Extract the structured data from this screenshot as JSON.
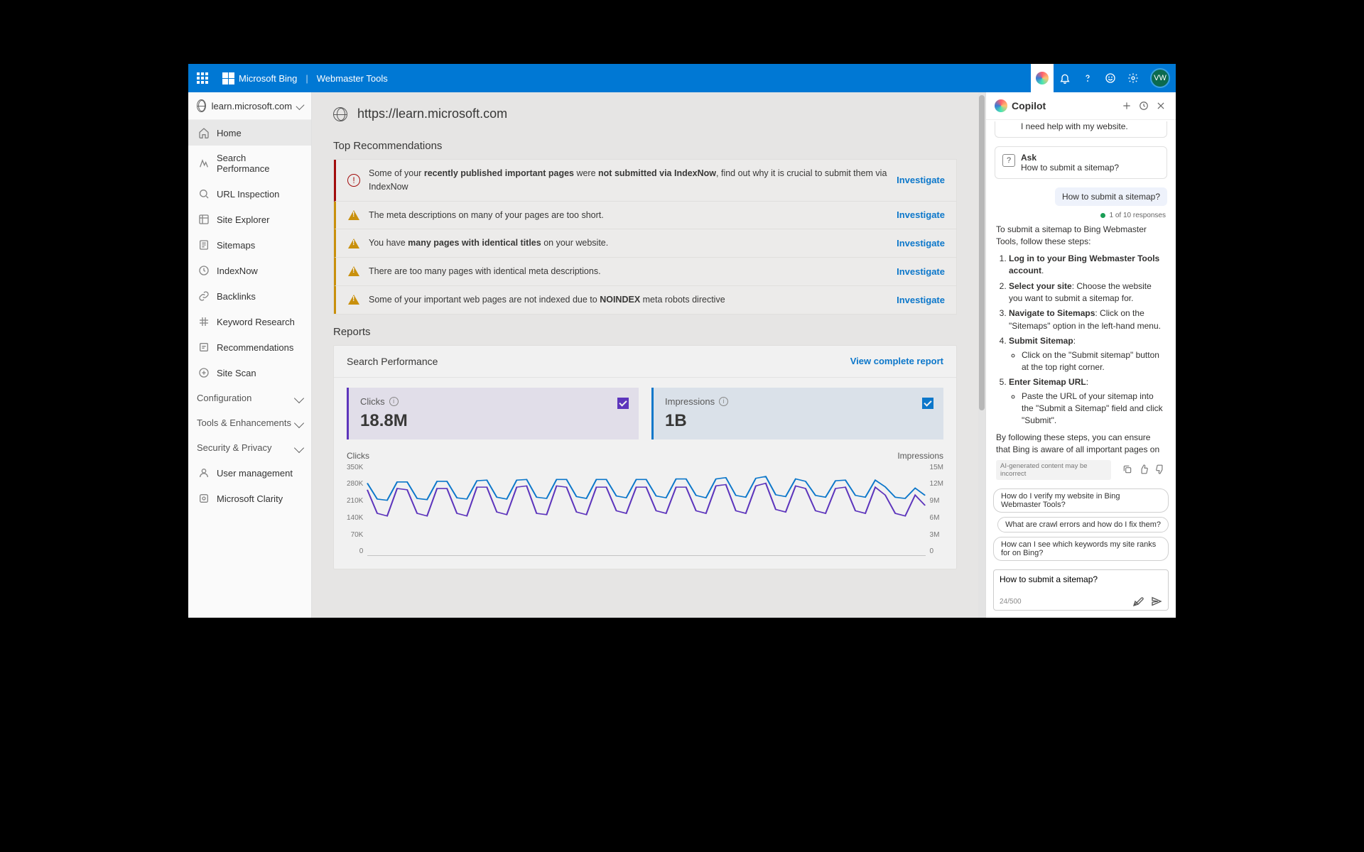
{
  "header": {
    "brand1": "Microsoft Bing",
    "brand2": "Webmaster Tools",
    "avatar": "VW"
  },
  "sidebar": {
    "site": "learn.microsoft.com",
    "items": [
      {
        "label": "Home",
        "active": true
      },
      {
        "label": "Search Performance"
      },
      {
        "label": "URL Inspection"
      },
      {
        "label": "Site Explorer"
      },
      {
        "label": "Sitemaps"
      },
      {
        "label": "IndexNow"
      },
      {
        "label": "Backlinks"
      },
      {
        "label": "Keyword Research"
      },
      {
        "label": "Recommendations"
      },
      {
        "label": "Site Scan"
      }
    ],
    "sections": [
      {
        "label": "Configuration"
      },
      {
        "label": "Tools & Enhancements"
      },
      {
        "label": "Security & Privacy"
      }
    ],
    "bottom": [
      {
        "label": "User management"
      },
      {
        "label": "Microsoft Clarity"
      }
    ]
  },
  "main": {
    "url": "https://learn.microsoft.com",
    "top_rec_title": "Top Recommendations",
    "investigate": "Investigate",
    "recs": [
      {
        "sev": "err",
        "html": "Some of your <b>recently published important pages</b> were <b>not submitted via IndexNow</b>, find out why it is crucial to submit them via IndexNow"
      },
      {
        "sev": "warn",
        "html": "The meta descriptions on many of your pages are too short."
      },
      {
        "sev": "warn",
        "html": "You have <b>many pages with identical titles</b> on your website."
      },
      {
        "sev": "warn",
        "html": "There are too many pages with identical meta descriptions."
      },
      {
        "sev": "warn",
        "html": "Some of your important web pages are not indexed due to <b>NOINDEX</b> meta robots directive"
      }
    ],
    "reports_title": "Reports",
    "report": {
      "title": "Search Performance",
      "view": "View complete report",
      "clicks_label": "Clicks",
      "clicks_value": "18.8M",
      "impr_label": "Impressions",
      "impr_value": "1B",
      "left_axis_label": "Clicks",
      "right_axis_label": "Impressions"
    }
  },
  "chart_data": {
    "type": "line",
    "xlabel": "",
    "ylabel_left": "Clicks",
    "ylabel_right": "Impressions",
    "left_ticks": [
      "350K",
      "280K",
      "210K",
      "140K",
      "70K",
      "0"
    ],
    "right_ticks": [
      "15M",
      "12M",
      "9M",
      "6M",
      "3M",
      "0"
    ],
    "left_range": [
      0,
      350000
    ],
    "right_range": [
      0,
      15000000
    ],
    "series": [
      {
        "name": "Clicks",
        "axis": "left",
        "color": "#5b2ec4",
        "values": [
          250000,
          160000,
          150000,
          255000,
          250000,
          160000,
          150000,
          255000,
          255000,
          160000,
          150000,
          260000,
          260000,
          165000,
          155000,
          260000,
          265000,
          160000,
          155000,
          265000,
          260000,
          165000,
          155000,
          260000,
          260000,
          170000,
          160000,
          260000,
          260000,
          170000,
          160000,
          260000,
          260000,
          170000,
          160000,
          265000,
          270000,
          170000,
          160000,
          265000,
          275000,
          175000,
          165000,
          265000,
          255000,
          170000,
          160000,
          255000,
          260000,
          170000,
          160000,
          260000,
          230000,
          160000,
          150000,
          230000,
          190000
        ]
      },
      {
        "name": "Impressions",
        "axis": "right",
        "color": "#0078D4",
        "values": [
          11800000,
          9200000,
          9000000,
          12000000,
          12000000,
          9300000,
          9100000,
          12100000,
          12100000,
          9400000,
          9200000,
          12200000,
          12300000,
          9500000,
          9200000,
          12300000,
          12400000,
          9500000,
          9300000,
          12400000,
          12400000,
          9600000,
          9300000,
          12400000,
          12400000,
          9700000,
          9400000,
          12400000,
          12400000,
          9700000,
          9400000,
          12500000,
          12500000,
          9800000,
          9400000,
          12500000,
          12700000,
          9800000,
          9500000,
          12600000,
          12900000,
          9900000,
          9600000,
          12500000,
          12100000,
          9800000,
          9500000,
          12200000,
          12300000,
          9800000,
          9500000,
          12300000,
          11200000,
          9500000,
          9300000,
          11000000,
          9800000
        ]
      }
    ]
  },
  "copilot": {
    "title": "Copilot",
    "sugg_top_text": "I need help with my website.",
    "sugg_ask_title": "Ask",
    "sugg_ask_text": "How to submit a sitemap?",
    "user_msg": "How to submit a sitemap?",
    "meta": "1 of 10 responses",
    "intro": "To submit a sitemap to Bing Webmaster Tools, follow these steps:",
    "step1_b": "Log in to your Bing Webmaster Tools account",
    "step1_t": ".",
    "step2_b": "Select your site",
    "step2_t": ": Choose the website you want to submit a sitemap for.",
    "step3_b": "Navigate to Sitemaps",
    "step3_t": ": Click on the \"Sitemaps\" option in the left-hand menu.",
    "step4_b": "Submit Sitemap",
    "step4_t": ":",
    "step4_li": "Click on the \"Submit sitemap\" button at the top right corner.",
    "step5_b": "Enter Sitemap URL",
    "step5_t": ":",
    "step5_li": "Paste the URL of your sitemap into the \"Submit a Sitemap\" field and click \"Submit\".",
    "outro": "By following these steps, you can ensure that Bing is aware of all important pages on your website and can index them efficiently.",
    "disclaimer": "AI-generated content may be incorrect",
    "followups": [
      "How do I verify my website in Bing Webmaster Tools?",
      "What are crawl errors and how do I fix them?",
      "How can I see which keywords my site ranks for on Bing?"
    ],
    "input_value": "How to submit a sitemap?",
    "counter": "24/500"
  }
}
